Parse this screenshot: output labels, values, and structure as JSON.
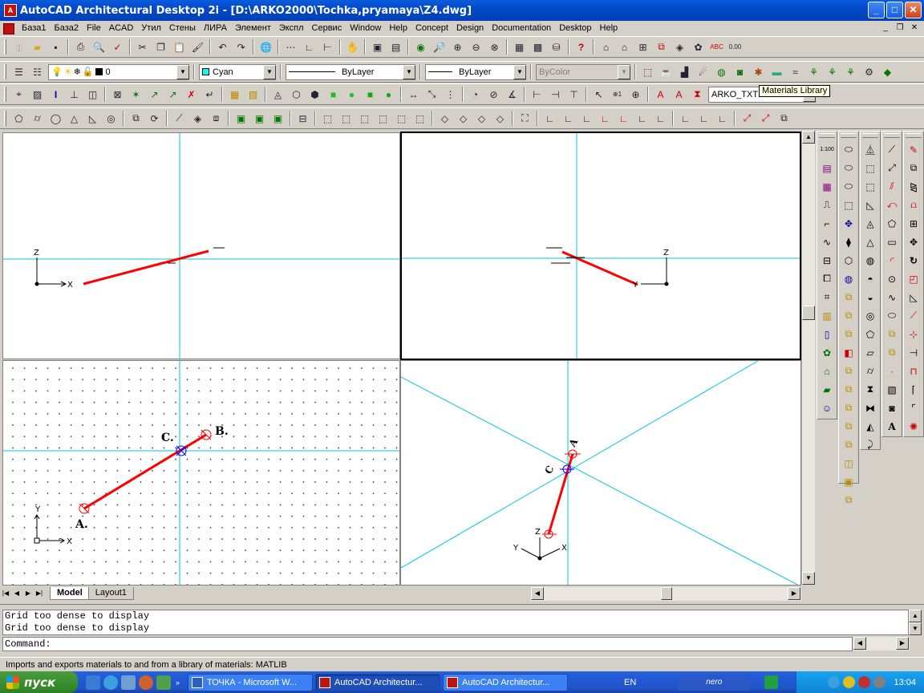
{
  "window": {
    "title": "AutoCAD Architectural Desktop 2i - [D:\\ARKO2000\\Tochka,pryamaya\\Z4.dwg]",
    "buttons": {
      "minimize": "_",
      "maximize": "□",
      "close": "✕"
    }
  },
  "menu": {
    "items": [
      "База1",
      "База2",
      "File",
      "ACAD",
      "Утил",
      "Стены",
      "ЛИРА",
      "Элемент",
      "Экспл",
      "Сервис",
      "Window",
      "Help",
      "Concept",
      "Design",
      "Documentation",
      "Desktop",
      "Help"
    ]
  },
  "layer_toolbar": {
    "layer_value": "0",
    "color_value": "Cyan",
    "color_hex": "#00ffff",
    "linetype_value": "ByLayer",
    "lineweight_value": "ByLayer",
    "plotstyle_value": "ByColor"
  },
  "toolbar3": {
    "style_combo_value": "ARKO_TXT"
  },
  "tooltip": "Materials Library",
  "viewports": {
    "top_left": {
      "axis_z": "Z",
      "axis_x": "X"
    },
    "top_right": {
      "axis_z": "Z",
      "axis_y": "Y"
    },
    "bottom_left": {
      "label_a": "A.",
      "label_b": "B.",
      "label_c": "C.",
      "axis_y": "Y",
      "axis_x": "X"
    },
    "bottom_right": {
      "label_a": "A",
      "label_c": "C",
      "axis_z": "Z",
      "axis_y": "Y",
      "axis_x": "X"
    }
  },
  "layout_tabs": [
    "Model",
    "Layout1"
  ],
  "command": {
    "history": [
      "Grid too dense to display",
      "Grid too dense to display"
    ],
    "prompt": "Command:"
  },
  "status": "Imports and exports materials to and from a library of materials:  MATLIB",
  "taskbar": {
    "start_label": "пуск",
    "tasks": [
      "ТОЧКА - Microsoft W...",
      "AutoCAD Architectur...",
      "AutoCAD Architectur..."
    ],
    "language": "EN",
    "nero": "nero",
    "clock": "13:04"
  },
  "colors": {
    "accent_red": "#ff0000",
    "crosshair": "#00c8e0"
  }
}
